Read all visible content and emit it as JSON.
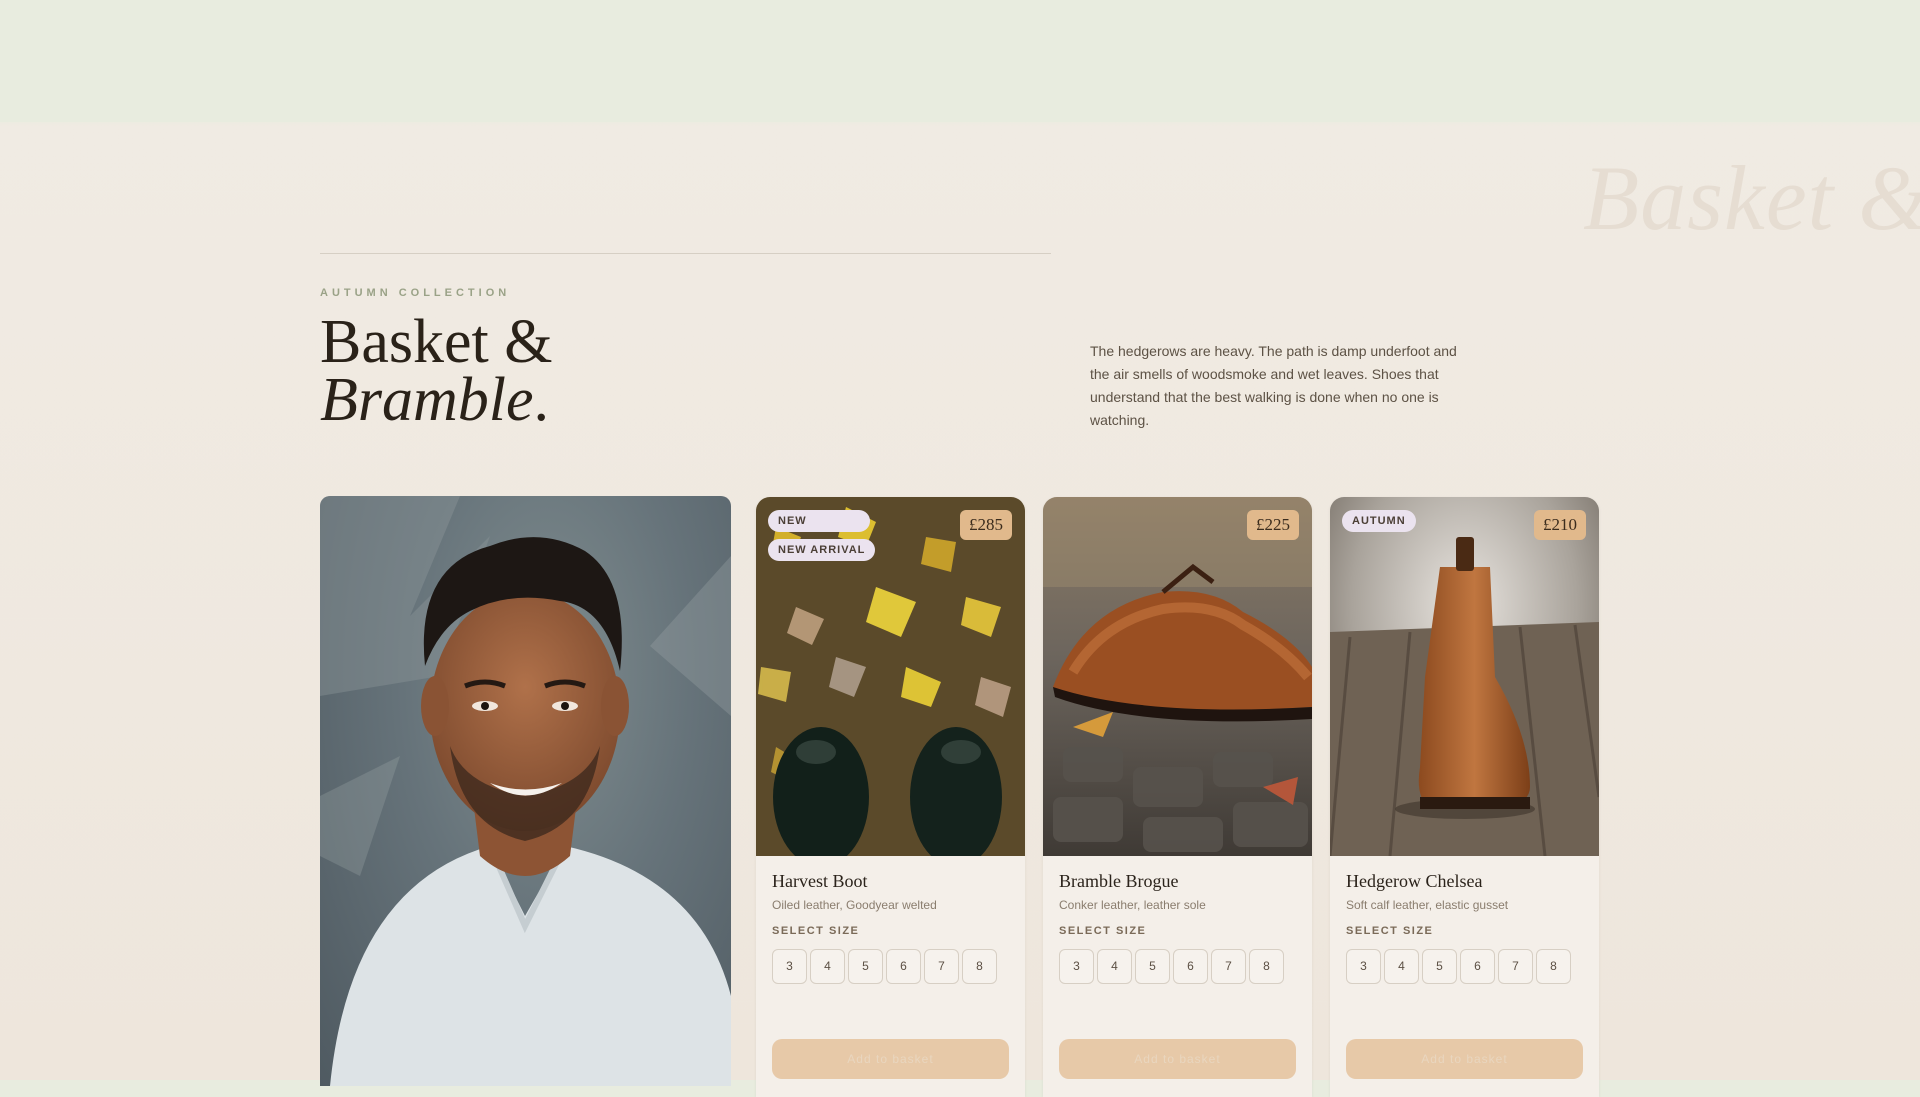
{
  "ghost_title": "Basket &",
  "hero": {
    "eyebrow": "AUTUMN COLLECTION",
    "title_line1": "Basket &",
    "title_line2_italic": "Bramble",
    "title_dot": ".",
    "intro": "The hedgerows are heavy. The path is damp underfoot and the air smells of woodsmoke and wet leaves. Shoes that understand that the best walking is done when no one is watching."
  },
  "products": [
    {
      "name": "Harvest Boot",
      "desc": "Oiled leather, Goodyear welted",
      "price": "£285",
      "badges": [
        "NEW",
        "NEW ARRIVAL"
      ],
      "size_label": "SELECT SIZE",
      "sizes": [
        "3",
        "4",
        "5",
        "6",
        "7",
        "8"
      ],
      "add_label": "Add to basket"
    },
    {
      "name": "Bramble Brogue",
      "desc": "Conker leather, leather sole",
      "price": "£225",
      "badges": [],
      "size_label": "SELECT SIZE",
      "sizes": [
        "3",
        "4",
        "5",
        "6",
        "7",
        "8"
      ],
      "add_label": "Add to basket"
    },
    {
      "name": "Hedgerow Chelsea",
      "desc": "Soft calf leather, elastic gusset",
      "price": "£210",
      "badges": [
        "AUTUMN"
      ],
      "size_label": "SELECT SIZE",
      "sizes": [
        "3",
        "4",
        "5",
        "6",
        "7",
        "8"
      ],
      "add_label": "Add to basket"
    }
  ],
  "colors": {
    "accent": "#e1b98c",
    "button": "#e7c9a8",
    "eyebrow": "#9aa287"
  }
}
